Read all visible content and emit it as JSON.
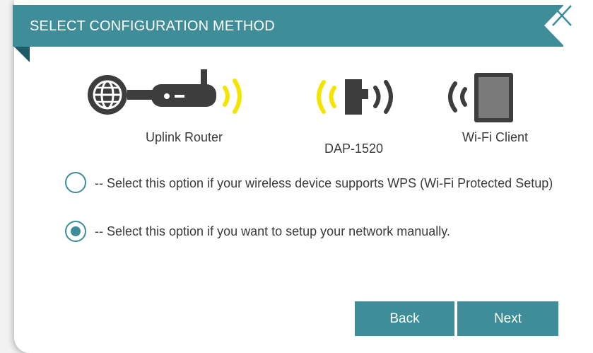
{
  "dialog": {
    "title": "SELECT CONFIGURATION METHOD",
    "close_icon": "close-x-icon"
  },
  "devices": {
    "uplink_router": "Uplink Router",
    "extender": "DAP-1520",
    "client": "Wi-Fi Client"
  },
  "options": [
    {
      "label": "-- Select this option if your wireless device supports WPS (Wi-Fi Protected Setup)",
      "selected": false
    },
    {
      "label": "-- Select this option if you want to setup your network manually.",
      "selected": true
    }
  ],
  "buttons": {
    "back": "Back",
    "next": "Next"
  },
  "colors": {
    "accent": "#3e8d99",
    "signal_yellow": "#f5e400",
    "icon_dark": "#3d3d3d"
  }
}
